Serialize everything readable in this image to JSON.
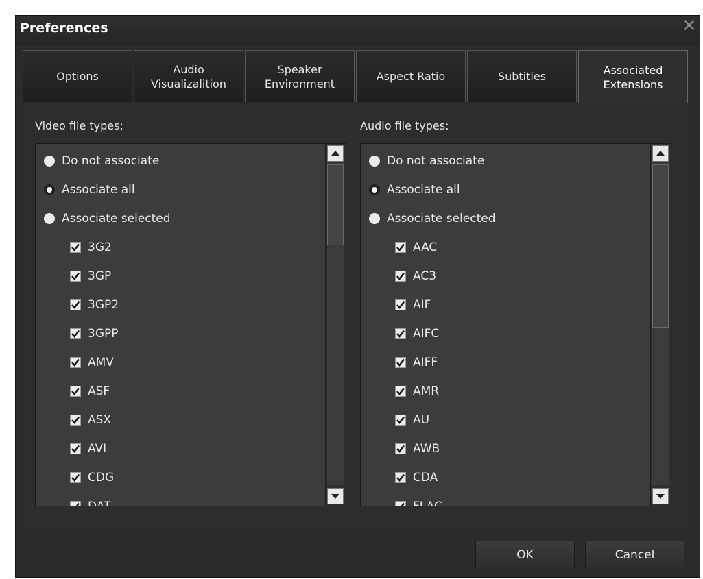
{
  "window": {
    "title": "Preferences",
    "close_icon": "close-icon"
  },
  "tabs": [
    {
      "label_line1": "Options",
      "label_line2": ""
    },
    {
      "label_line1": "Audio",
      "label_line2": "Visualizalition"
    },
    {
      "label_line1": "Speaker",
      "label_line2": "Environment"
    },
    {
      "label_line1": "Aspect Ratio",
      "label_line2": ""
    },
    {
      "label_line1": "Subtitles",
      "label_line2": ""
    },
    {
      "label_line1": "Associated",
      "label_line2": "Extensions"
    }
  ],
  "video": {
    "label": "Video file types:",
    "radios": [
      {
        "label": "Do not associate",
        "checked": false
      },
      {
        "label": "Associate all",
        "checked": true
      },
      {
        "label": "Associate selected",
        "checked": false
      }
    ],
    "types": [
      "3G2",
      "3GP",
      "3GP2",
      "3GPP",
      "AMV",
      "ASF",
      "ASX",
      "AVI",
      "CDG",
      "DAT"
    ]
  },
  "audio": {
    "label": "Audio file types:",
    "radios": [
      {
        "label": "Do not associate",
        "checked": false
      },
      {
        "label": "Associate all",
        "checked": true
      },
      {
        "label": "Associate selected",
        "checked": false
      }
    ],
    "types": [
      "AAC",
      "AC3",
      "AIF",
      "AIFC",
      "AIFF",
      "AMR",
      "AU",
      "AWB",
      "CDA",
      "FLAC"
    ]
  },
  "buttons": {
    "ok": "OK",
    "cancel": "Cancel"
  },
  "colors": {
    "window_bg": "#2b2b2b",
    "list_bg": "#3c3c3c",
    "text": "#eaeaea"
  }
}
